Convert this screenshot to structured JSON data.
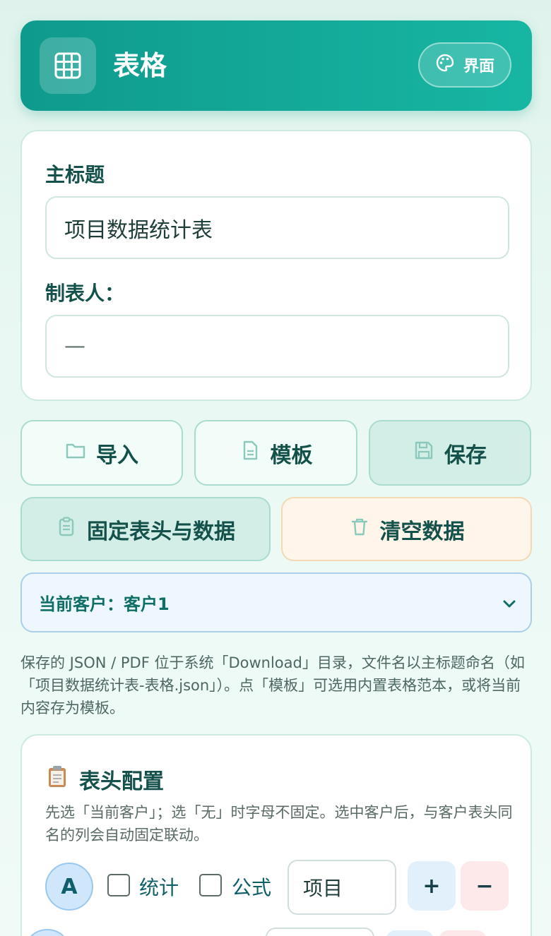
{
  "header": {
    "title": "表格",
    "theme_label": "界面",
    "icons": {
      "logo": "grid-table-icon",
      "theme": "palette-icon"
    }
  },
  "form": {
    "main_title_label": "主标题",
    "main_title_value": "项目数据统计表",
    "maker_label": "制表人：",
    "maker_value": "—"
  },
  "actions": {
    "import": "导入",
    "template": "模板",
    "save": "保存",
    "pin": "固定表头与数据",
    "clear": "清空数据"
  },
  "client_select": {
    "value": "当前客户：客户1"
  },
  "note": "保存的 JSON / PDF 位于系统「Download」目录，文件名以主标题命名（如「项目数据统计表-表格.json」）。点「模板」可选用内置表格范本，或将当前内容存为模板。",
  "header_config": {
    "title": "表头配置",
    "title_icon": "clipboard-icon",
    "desc": "先选「当前客户」；选「无」时字母不固定。选中客户后，与客户表头同名的列会自动固定联动。",
    "rows": [
      {
        "letter": "A",
        "stat_label": "统计",
        "formula_label": "公式",
        "name": "项目",
        "stat_checked": false,
        "formula_checked": false
      }
    ],
    "add_label": "+",
    "remove_label": "−"
  },
  "colors": {
    "accent": "#0f9a8d",
    "accent_light": "#17b6a3",
    "text_dark": "#14514a",
    "warn_bg": "#fff5ea",
    "select_bg": "#eef6ff"
  }
}
